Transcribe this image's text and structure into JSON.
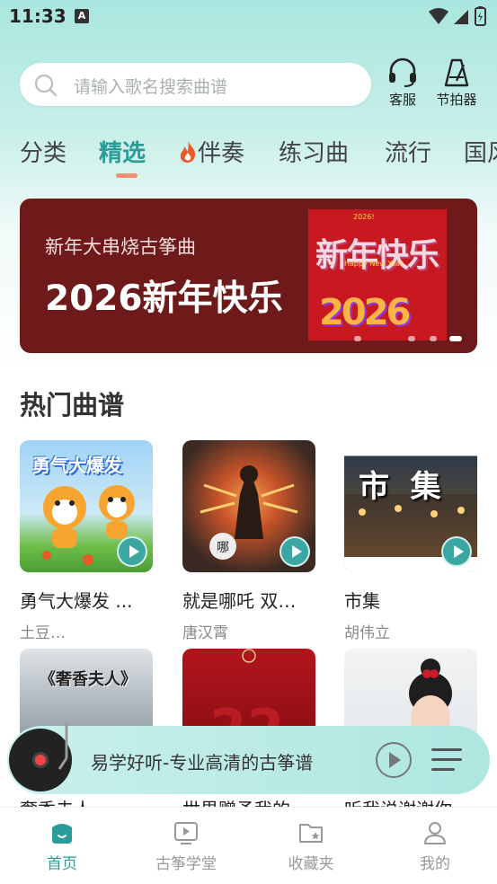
{
  "status": {
    "time": "11:33",
    "notice": "A"
  },
  "search": {
    "placeholder": "请输入歌名搜索曲谱"
  },
  "top_actions": [
    {
      "label": "客服",
      "icon": "headset-icon"
    },
    {
      "label": "节拍器",
      "icon": "metronome-icon"
    }
  ],
  "tabs": [
    {
      "label": "分类",
      "active": false
    },
    {
      "label": "精选",
      "active": true
    },
    {
      "label": "伴奏",
      "active": false,
      "icon": "fire-icon"
    },
    {
      "label": "练习曲",
      "active": false
    },
    {
      "label": "流行",
      "active": false
    },
    {
      "label": "国风",
      "active": false
    }
  ],
  "banner": {
    "subtitle": "新年大串烧古筝曲",
    "title": "2026新年快乐",
    "image_text": {
      "main": "新年快乐",
      "english": "Happy New Year",
      "year_badge": "2026!",
      "year": "2026"
    },
    "slides": 4,
    "active_slide": 3
  },
  "section": {
    "title": "热门曲谱"
  },
  "cards": [
    {
      "title": "勇气大爆发 ...",
      "artist": "土豆…",
      "cover_text": "勇气大爆发",
      "colors": [
        "#9fd3f5",
        "#f7b733"
      ]
    },
    {
      "title": "就是哪吒  双…",
      "artist": "唐汉霄",
      "cover_text": "",
      "colors": [
        "#3b2a24",
        "#c9542a"
      ]
    },
    {
      "title": "市集",
      "artist": "胡伟立",
      "cover_text": "市  集",
      "colors": [
        "#2c3a48",
        "#b57a3a"
      ]
    },
    {
      "title": "奢香夫人",
      "artist": "",
      "cover_text": "《奢香夫人》",
      "colors": [
        "#dfe3e6",
        "#6b7884"
      ]
    },
    {
      "title": "世界赠予我的",
      "artist": "",
      "cover_text": "",
      "colors": [
        "#b3141c",
        "#7a0c10"
      ]
    },
    {
      "title": "听我说谢谢你",
      "artist": "",
      "cover_text": "",
      "colors": [
        "#f3f3f3",
        "#cfd9e0"
      ]
    }
  ],
  "player": {
    "title": "易学好听-专业高清的古筝谱"
  },
  "bottom_nav": [
    {
      "label": "首页",
      "active": true,
      "icon": "home-icon"
    },
    {
      "label": "古筝学堂",
      "active": false,
      "icon": "video-icon"
    },
    {
      "label": "收藏夹",
      "active": false,
      "icon": "favorite-folder-icon"
    },
    {
      "label": "我的",
      "active": false,
      "icon": "profile-icon"
    }
  ],
  "colors": {
    "accent": "#2a9d98",
    "indicator": "#f08e76",
    "banner_bg": "#6e1a1a"
  }
}
